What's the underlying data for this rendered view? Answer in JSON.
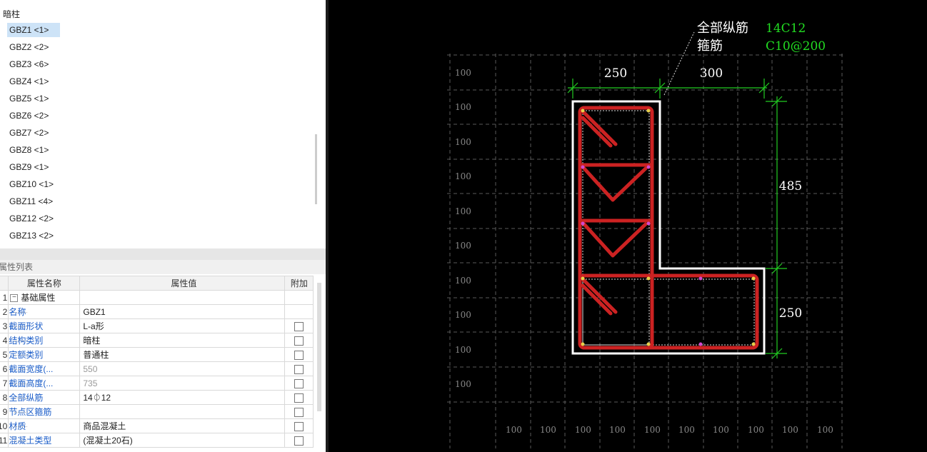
{
  "tree": {
    "root_label": "暗柱",
    "items": [
      {
        "label": "GBZ1 <1>",
        "selected": true
      },
      {
        "label": "GBZ2 <2>"
      },
      {
        "label": "GBZ3 <6>"
      },
      {
        "label": "GBZ4 <1>"
      },
      {
        "label": "GBZ5 <1>"
      },
      {
        "label": "GBZ6 <2>"
      },
      {
        "label": "GBZ7 <2>"
      },
      {
        "label": "GBZ8 <1>"
      },
      {
        "label": "GBZ9 <1>"
      },
      {
        "label": "GBZ10 <1>"
      },
      {
        "label": "GBZ11 <4>"
      },
      {
        "label": "GBZ12 <2>"
      },
      {
        "label": "GBZ13 <2>"
      }
    ]
  },
  "properties": {
    "panel_title": "属性列表",
    "headers": {
      "name": "属性名称",
      "value": "属性值",
      "extra": "附加"
    },
    "group_label": "基础属性",
    "group_index": "1",
    "rows": [
      {
        "idx": "2",
        "name": "名称",
        "value": "GBZ1",
        "checkbox": false,
        "dim": false
      },
      {
        "idx": "3",
        "name": "截面形状",
        "value": "L-a形",
        "checkbox": true,
        "dim": false
      },
      {
        "idx": "4",
        "name": "结构类别",
        "value": "暗柱",
        "checkbox": true,
        "dim": false
      },
      {
        "idx": "5",
        "name": "定额类别",
        "value": "普通柱",
        "checkbox": true,
        "dim": false
      },
      {
        "idx": "6",
        "name": "截面宽度(...",
        "value": "550",
        "checkbox": true,
        "dim": true
      },
      {
        "idx": "7",
        "name": "截面高度(...",
        "value": "735",
        "checkbox": true,
        "dim": true
      },
      {
        "idx": "8",
        "name": "全部纵筋",
        "value": "14⏀12",
        "checkbox": true,
        "dim": false
      },
      {
        "idx": "9",
        "name": "节点区箍筋",
        "value": "",
        "checkbox": true,
        "dim": false
      },
      {
        "idx": "10",
        "name": "材质",
        "value": "商品混凝土",
        "checkbox": true,
        "dim": false
      },
      {
        "idx": "11",
        "name": "混凝土类型",
        "value": "(混凝土20石)",
        "checkbox": true,
        "dim": false
      }
    ]
  },
  "drawing": {
    "legend": {
      "longitudinal_label": "全部纵筋",
      "longitudinal_value": "14C12",
      "stirrup_label": "箍筋",
      "stirrup_value": "C10@200"
    },
    "dimensions": {
      "top_left": "250",
      "top_right": "300",
      "right_upper": "485",
      "right_lower": "250"
    },
    "grid_label": "100",
    "colors": {
      "background": "#000000",
      "outline": "#ffffff",
      "rebar": "#cc2222",
      "dimension": "#22cc22",
      "legend_value": "#22dd22",
      "grid": "#5a5a5a",
      "node_yellow": "#e8d04a",
      "node_magenta": "#d04ad0"
    }
  }
}
